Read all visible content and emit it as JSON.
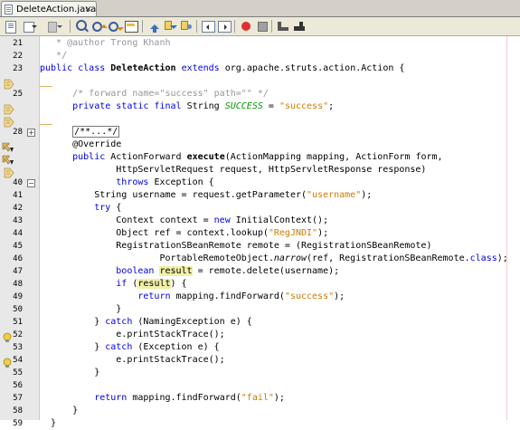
{
  "tab": {
    "title": "DeleteAction.java",
    "close": "×"
  },
  "toolbar": {
    "icons": [
      "history-icon",
      "back-icon",
      "forward-icon",
      "find-icon",
      "find-prev-icon",
      "find-next-icon",
      "toggle-highlight-icon",
      "prev-bookmark-icon",
      "next-bookmark-icon",
      "toggle-bookmark-icon",
      "shift-left-icon",
      "shift-right-icon",
      "record-macro-icon",
      "stop-macro-icon",
      "comment-icon",
      "uncomment-icon"
    ]
  },
  "lines": [
    {
      "n": "21",
      "t": [
        [
          "cm",
          "   * @author Trong Khanh"
        ]
      ]
    },
    {
      "n": "22",
      "t": [
        [
          "cm",
          "   */"
        ]
      ]
    },
    {
      "n": "23",
      "t": [
        [
          "kw",
          "public class "
        ],
        [
          "b",
          "DeleteAction "
        ],
        [
          "kw",
          "extends "
        ],
        [
          "",
          "org.apache.struts.action.Action {"
        ]
      ]
    },
    {
      "n": "",
      "t": []
    },
    {
      "n": "25",
      "t": [
        [
          "cm",
          "      /* forward name=\"success\" path=\"\" */"
        ]
      ]
    },
    {
      "n": "",
      "t": [
        [
          "kw",
          "      private static final "
        ],
        [
          "",
          "String "
        ],
        [
          "fld",
          "SUCCESS"
        ],
        [
          "",
          " = "
        ],
        [
          "st",
          "\"success\""
        ],
        [
          "",
          ";"
        ]
      ]
    },
    {
      "n": "",
      "t": []
    },
    {
      "n": "28",
      "t": [
        [
          "box",
          "/**...*/"
        ]
      ]
    },
    {
      "n": "",
      "t": [
        [
          "",
          "      @Override"
        ]
      ]
    },
    {
      "n": "",
      "t": [
        [
          "kw",
          "      public "
        ],
        [
          "",
          "ActionForward "
        ],
        [
          "b",
          "execute"
        ],
        [
          "",
          "(ActionMapping mapping, ActionForm form,"
        ]
      ]
    },
    {
      "n": "",
      "t": [
        [
          "",
          "              HttpServletRequest request, HttpServletResponse response)"
        ]
      ]
    },
    {
      "n": "40",
      "t": [
        [
          "kw",
          "              throws "
        ],
        [
          "",
          "Exception {"
        ]
      ]
    },
    {
      "n": "41",
      "t": [
        [
          "",
          "          String username = request.getParameter("
        ],
        [
          "st",
          "\"username\""
        ],
        [
          "",
          ");"
        ]
      ]
    },
    {
      "n": "42",
      "t": [
        [
          "kw",
          "          try "
        ],
        [
          "",
          "{"
        ]
      ]
    },
    {
      "n": "43",
      "t": [
        [
          "",
          "              Context context = "
        ],
        [
          "kw",
          "new "
        ],
        [
          "",
          "InitialContext();"
        ]
      ]
    },
    {
      "n": "44",
      "t": [
        [
          "",
          "              Object ref = context.lookup("
        ],
        [
          "st",
          "\"RegJNDI\""
        ],
        [
          "",
          ");"
        ]
      ]
    },
    {
      "n": "45",
      "t": [
        [
          "",
          "              RegistrationSBeanRemote remote = (RegistrationSBeanRemote)"
        ]
      ]
    },
    {
      "n": "46",
      "t": [
        [
          "",
          "                      PortableRemoteObject."
        ],
        [
          "it",
          "narrow"
        ],
        [
          "",
          "(ref, RegistrationSBeanRemote."
        ],
        [
          "kw",
          "class"
        ],
        [
          "",
          ");"
        ]
      ]
    },
    {
      "n": "47",
      "t": [
        [
          "kw",
          "              boolean "
        ],
        [
          "hl",
          "result"
        ],
        [
          "",
          " = remote.delete(username);"
        ]
      ]
    },
    {
      "n": "48",
      "t": [
        [
          "kw",
          "              if "
        ],
        [
          "",
          "("
        ],
        [
          "hl",
          "result"
        ],
        [
          "",
          ") {"
        ]
      ]
    },
    {
      "n": "49",
      "t": [
        [
          "kw",
          "                  return "
        ],
        [
          "",
          "mapping.findForward("
        ],
        [
          "st",
          "\"success\""
        ],
        [
          "",
          ");"
        ]
      ]
    },
    {
      "n": "50",
      "t": [
        [
          "",
          "              }"
        ]
      ]
    },
    {
      "n": "51",
      "t": [
        [
          "",
          "          } "
        ],
        [
          "kw",
          "catch "
        ],
        [
          "",
          "(NamingException e) {"
        ]
      ]
    },
    {
      "n": "52",
      "t": [
        [
          "",
          "              e.printStackTrace();"
        ]
      ]
    },
    {
      "n": "53",
      "t": [
        [
          "",
          "          } "
        ],
        [
          "kw",
          "catch "
        ],
        [
          "",
          "(Exception e) {"
        ]
      ]
    },
    {
      "n": "54",
      "t": [
        [
          "",
          "              e.printStackTrace();"
        ]
      ]
    },
    {
      "n": "55",
      "t": [
        [
          "",
          "          }"
        ]
      ]
    },
    {
      "n": "56",
      "t": []
    },
    {
      "n": "57",
      "t": [
        [
          "kw",
          "          return "
        ],
        [
          "",
          "mapping.findForward("
        ],
        [
          "st",
          "\"fail\""
        ],
        [
          "",
          ");"
        ]
      ]
    },
    {
      "n": "58",
      "t": [
        [
          "",
          "      }"
        ]
      ]
    },
    {
      "n": "59",
      "t": [
        [
          "",
          "  }"
        ]
      ]
    }
  ],
  "gutter_marks": {
    "3": "hint-icon",
    "5": "hint-icon",
    "6": "hint-icon",
    "8": "override-icon",
    "9": "override-icon",
    "10": "hint-icon",
    "23": "warning-bulb-icon",
    "25": "warning-bulb-icon"
  },
  "folds": {
    "7": "+",
    "11": "−"
  },
  "colors": {
    "keyword": "#0000e6",
    "comment": "#969696",
    "string": "#ce7b00",
    "field": "#009900",
    "highlight": "#f0f0a8",
    "gutter": "#e8e8e8"
  }
}
